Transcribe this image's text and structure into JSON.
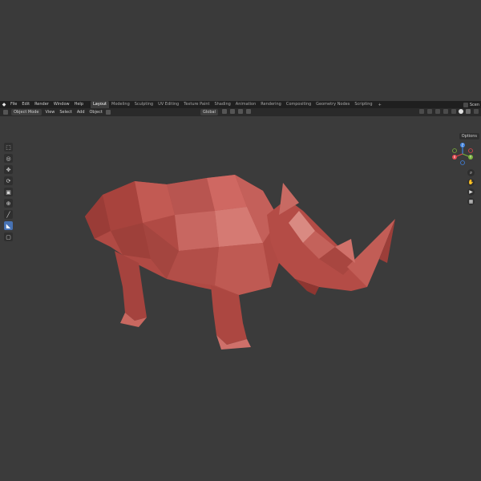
{
  "app": {
    "logo_glyph": "◆",
    "menu": [
      "File",
      "Edit",
      "Render",
      "Window",
      "Help"
    ],
    "workspace_tabs": [
      {
        "label": "Layout",
        "active": true
      },
      {
        "label": "Modeling",
        "active": false
      },
      {
        "label": "Sculpting",
        "active": false
      },
      {
        "label": "UV Editing",
        "active": false
      },
      {
        "label": "Texture Paint",
        "active": false
      },
      {
        "label": "Shading",
        "active": false
      },
      {
        "label": "Animation",
        "active": false
      },
      {
        "label": "Rendering",
        "active": false
      },
      {
        "label": "Compositing",
        "active": false
      },
      {
        "label": "Geometry Nodes",
        "active": false
      },
      {
        "label": "Scripting",
        "active": false
      }
    ],
    "add_workspace_label": "+",
    "scene_label": "Scen"
  },
  "header": {
    "mode": "Object Mode",
    "view": "View",
    "select": "Select",
    "add": "Add",
    "object": "Object",
    "orientation": "Global"
  },
  "viewport": {
    "options_label": "Options",
    "tools": [
      {
        "name": "select-box-icon",
        "glyph": "⬚"
      },
      {
        "name": "cursor-icon",
        "glyph": "◎"
      },
      {
        "name": "move-icon",
        "glyph": "✥"
      },
      {
        "name": "rotate-icon",
        "glyph": "⟳"
      },
      {
        "name": "scale-icon",
        "glyph": "▣"
      },
      {
        "name": "transform-icon",
        "glyph": "⊕"
      },
      {
        "name": "annotate-icon",
        "glyph": "╱"
      },
      {
        "name": "measure-icon",
        "glyph": "◣"
      },
      {
        "name": "add-cube-icon",
        "glyph": "▢"
      }
    ],
    "active_tool_index": 7,
    "gizmo": {
      "x": "X",
      "y": "Y",
      "z": "Z"
    },
    "nav_buttons": [
      {
        "name": "zoom-icon",
        "glyph": "⌕"
      },
      {
        "name": "pan-hand-icon",
        "glyph": "✋"
      },
      {
        "name": "camera-icon",
        "glyph": "▶"
      },
      {
        "name": "perspective-grid-icon",
        "glyph": "▦"
      }
    ]
  },
  "colors": {
    "accent": "#4772b3",
    "model": "#b5504a",
    "axis_x": "#e0444b",
    "axis_y": "#79b13a",
    "axis_z": "#3f82e0"
  }
}
